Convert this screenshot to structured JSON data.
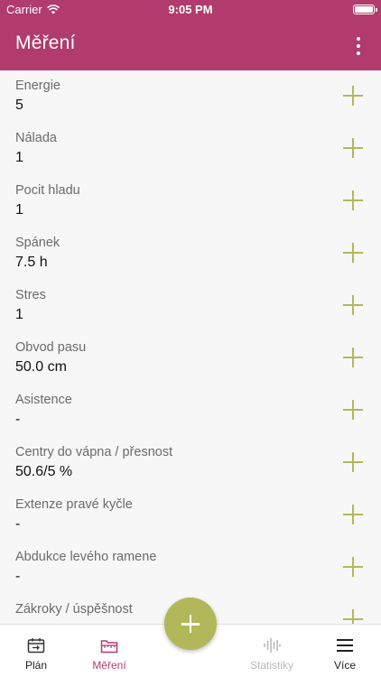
{
  "status_bar": {
    "carrier": "Carrier",
    "time": "9:05 PM"
  },
  "app_bar": {
    "title": "Měření"
  },
  "measurements": [
    {
      "label": "Energie",
      "value": "5"
    },
    {
      "label": "Nálada",
      "value": "1"
    },
    {
      "label": "Pocit hladu",
      "value": "1"
    },
    {
      "label": "Spánek",
      "value": "7.5 h"
    },
    {
      "label": "Stres",
      "value": "1"
    },
    {
      "label": "Obvod pasu",
      "value": "50.0 cm"
    },
    {
      "label": "Asistence",
      "value": "-"
    },
    {
      "label": "Centry do vápna / přesnost",
      "value": "50.6/5 %"
    },
    {
      "label": "Extenze pravé kyčle",
      "value": "-"
    },
    {
      "label": "Abdukce levého ramene",
      "value": "-"
    },
    {
      "label": "Zákroky / úspěšnost",
      "value": ""
    }
  ],
  "tabs": [
    {
      "label": "Plán",
      "icon": "calendar-icon",
      "state": "normal"
    },
    {
      "label": "Měření",
      "icon": "folder-ruler-icon",
      "state": "active"
    },
    {
      "label": "Statistiky",
      "icon": "waveform-icon",
      "state": "disabled"
    },
    {
      "label": "Více",
      "icon": "menu-icon",
      "state": "normal"
    }
  ],
  "colors": {
    "primary": "#b13b6c",
    "accent": "#b2b85a",
    "background": "#f7f7f7"
  }
}
